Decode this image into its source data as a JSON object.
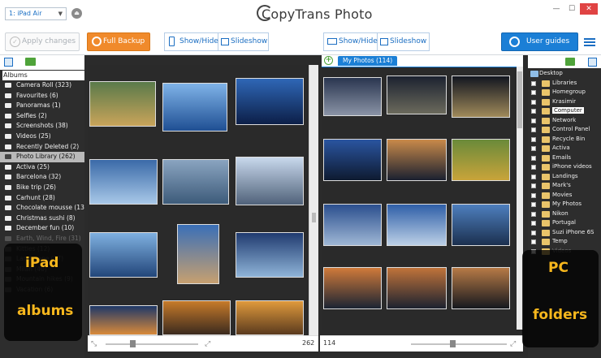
{
  "titlebar": {
    "device": "1: iPad Air",
    "app_title": "CopyTrans Photo"
  },
  "toolbar": {
    "apply_label": "Apply changes",
    "backup_label": "Full Backup",
    "left_show_hide": "Show/Hide",
    "left_slideshow": "Slideshow",
    "right_show_hide": "Show/Hide",
    "right_slideshow": "Slideshow",
    "guides_label": "User guides"
  },
  "left_sidebar": {
    "albums_heading": "Albums",
    "albums": [
      {
        "label": "Camera Roll (323)",
        "state": "normal"
      },
      {
        "label": "Favourites (6)",
        "state": "normal"
      },
      {
        "label": "Panoramas (1)",
        "state": "normal"
      },
      {
        "label": "Selfies (2)",
        "state": "normal"
      },
      {
        "label": "Screenshots (38)",
        "state": "normal"
      },
      {
        "label": "Videos (25)",
        "state": "normal"
      },
      {
        "label": "Recently Deleted (2)",
        "state": "normal"
      },
      {
        "label": "Photo Library (262)",
        "state": "selected"
      },
      {
        "label": "Activa (25)",
        "state": "normal"
      },
      {
        "label": "Barcelona (32)",
        "state": "normal"
      },
      {
        "label": "Bike trip (26)",
        "state": "normal"
      },
      {
        "label": "Carhunt (28)",
        "state": "normal"
      },
      {
        "label": "Chocolate mousse (13)",
        "state": "normal"
      },
      {
        "label": "Christmas sushi (8)",
        "state": "normal"
      },
      {
        "label": "December fun (10)",
        "state": "normal"
      },
      {
        "label": "Earth, Wind, Fire (31)",
        "state": "faded"
      },
      {
        "label": "Kitties (12)",
        "state": "faded"
      },
      {
        "label": "Landscape (17)",
        "state": "faded"
      },
      {
        "label": "Milan (40)",
        "state": "faded"
      },
      {
        "label": "Mountain hikes (9)",
        "state": "faded"
      },
      {
        "label": "Vacation (6)",
        "state": "faded"
      }
    ],
    "overlay_line1": "iPad",
    "overlay_line2": "albums"
  },
  "ipad_pane": {
    "count": "262",
    "thumbs": [
      {
        "c1": "#5a7a4a",
        "c2": "#c9a45a"
      },
      {
        "c1": "#7fb3e8",
        "c2": "#1f4f93"
      },
      {
        "c1": "#2f67b6",
        "c2": "#0c1f48"
      },
      {
        "c1": "#3b6aa8",
        "c2": "#a8c8e8"
      },
      {
        "c1": "#8aa4c0",
        "c2": "#3d5b7a"
      },
      {
        "c1": "#c8d8ec",
        "c2": "#50627a"
      },
      {
        "c1": "#7fb0e0",
        "c2": "#22467a"
      },
      {
        "c1": "#3a6fb8",
        "c2": "#c7a070"
      },
      {
        "c1": "#203b70",
        "c2": "#8fb4d8"
      },
      {
        "c1": "#1e3868",
        "c2": "#d98a3a"
      },
      {
        "c1": "#c77b2a",
        "c2": "#3b2a1e"
      },
      {
        "c1": "#e09a3c",
        "c2": "#5a3a1e"
      }
    ]
  },
  "pc_pane": {
    "tab_label": "My Photos (114)",
    "count": "114",
    "thumbs": [
      {
        "c1": "#2a3650",
        "c2": "#8a93a6"
      },
      {
        "c1": "#1c2230",
        "c2": "#6b6a5c"
      },
      {
        "c1": "#121620",
        "c2": "#a08a5a"
      },
      {
        "c1": "#2a55a0",
        "c2": "#0e1a30"
      },
      {
        "c1": "#c98a4a",
        "c2": "#1a2030"
      },
      {
        "c1": "#6a8a3a",
        "c2": "#c9a43a"
      },
      {
        "c1": "#2b4f8e",
        "c2": "#9fb7d5"
      },
      {
        "c1": "#2f5fa8",
        "c2": "#bcd0e6"
      },
      {
        "c1": "#4e7fbe",
        "c2": "#1c304f"
      },
      {
        "c1": "#d07a3a",
        "c2": "#1b2433"
      },
      {
        "c1": "#c0733a",
        "c2": "#1c2230"
      },
      {
        "c1": "#b77a46",
        "c2": "#15181e"
      }
    ]
  },
  "right_sidebar": {
    "folders": [
      {
        "label": "Desktop",
        "kind": "top"
      },
      {
        "label": "Libraries",
        "kind": "normal"
      },
      {
        "label": "Homegroup",
        "kind": "normal"
      },
      {
        "label": "Krasimir",
        "kind": "normal"
      },
      {
        "label": "Computer",
        "kind": "highlight"
      },
      {
        "label": "Network",
        "kind": "normal"
      },
      {
        "label": "Control Panel",
        "kind": "normal"
      },
      {
        "label": "Recycle Bin",
        "kind": "normal"
      },
      {
        "label": "Activa",
        "kind": "normal"
      },
      {
        "label": "Emails",
        "kind": "normal"
      },
      {
        "label": "iPhone videos",
        "kind": "normal"
      },
      {
        "label": "Landings",
        "kind": "normal"
      },
      {
        "label": "Mark's",
        "kind": "normal"
      },
      {
        "label": "Movies",
        "kind": "normal"
      },
      {
        "label": "My Photos",
        "kind": "normal"
      },
      {
        "label": "Nikon",
        "kind": "normal"
      },
      {
        "label": "Portugal",
        "kind": "normal"
      },
      {
        "label": "Suzi iPhone 6S",
        "kind": "normal"
      },
      {
        "label": "Temp",
        "kind": "normal"
      },
      {
        "label": "Videos",
        "kind": "faded"
      }
    ],
    "overlay_line1": "PC",
    "overlay_line2": "folders"
  },
  "colors": {
    "accent_blue": "#1b7fd6",
    "backup_orange": "#f08a2b",
    "overlay_text": "#f7b71d"
  }
}
